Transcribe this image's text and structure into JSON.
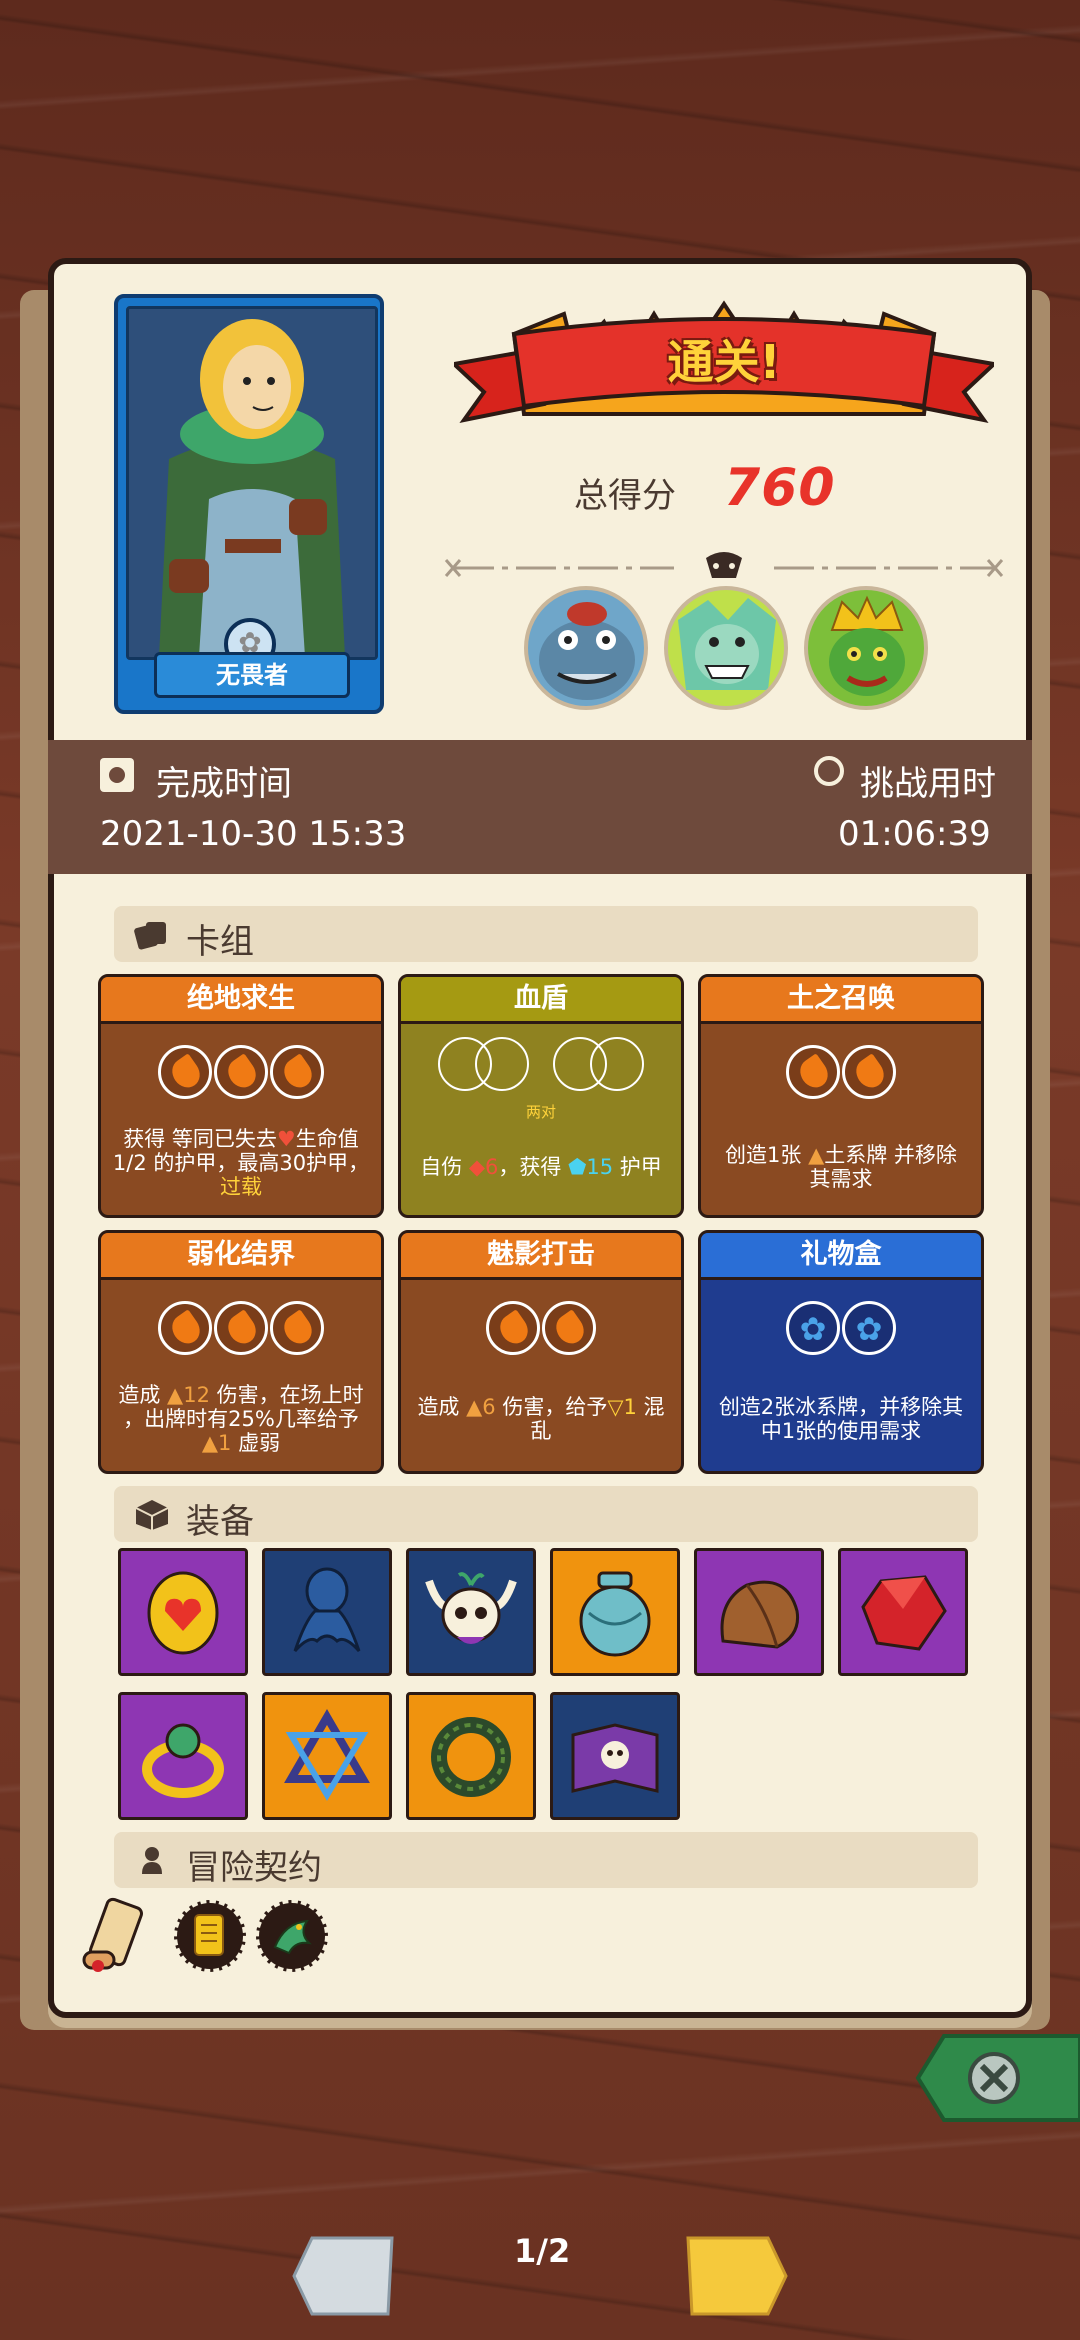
{
  "hero": {
    "name": "无畏者"
  },
  "banner": {
    "text": "通关!"
  },
  "score": {
    "label": "总得分",
    "value": "760"
  },
  "bosses": [
    {
      "name": "boss-toad"
    },
    {
      "name": "boss-fish-monster"
    },
    {
      "name": "boss-goblin-king"
    }
  ],
  "time": {
    "completion_label": "完成时间",
    "completion_value": "2021-10-30 15:33",
    "challenge_label": "挑战用时",
    "challenge_value": "01:06:39"
  },
  "sections": {
    "deck": "卡组",
    "equipment": "装备",
    "contract": "冒险契约"
  },
  "deck": [
    {
      "title": "绝地求生",
      "color": "orange",
      "gems": [
        "fire",
        "fire",
        "fire"
      ],
      "desc": [
        "获得 等同已失去",
        "生命值",
        "1/2 的护甲，最高30护甲，",
        "过载"
      ]
    },
    {
      "title": "血盾",
      "color": "olive",
      "gems": [
        "ring",
        "ring",
        "ring",
        "ring"
      ],
      "sub": "两对",
      "desc": [
        "自伤 ",
        "6",
        "，获得 ",
        "15",
        " 护甲"
      ]
    },
    {
      "title": "土之召唤",
      "color": "orange",
      "gems": [
        "fire",
        "fire"
      ],
      "desc": [
        "创造1张 ",
        "土系牌 并移除",
        "其需求"
      ]
    },
    {
      "title": "弱化结界",
      "color": "orange",
      "gems": [
        "fire",
        "fire",
        "fire"
      ],
      "desc": [
        "造成 ",
        "12",
        " 伤害，在场上时",
        "，出牌时有25%几率给予",
        "1",
        " 虚弱"
      ]
    },
    {
      "title": "魅影打击",
      "color": "orange",
      "gems": [
        "fire",
        "fire"
      ],
      "desc": [
        "造成 ",
        "6",
        " 伤害，给予",
        "1",
        " 混",
        "乱"
      ]
    },
    {
      "title": "礼物盒",
      "color": "blue",
      "gems": [
        "ice",
        "ice"
      ],
      "desc": [
        "创造2张冰系牌，并移除其",
        "中1张的使用需求"
      ]
    }
  ],
  "equipment": [
    {
      "icon": "heart-stone-icon",
      "bg": "purple"
    },
    {
      "icon": "kraken-icon",
      "bg": "navy"
    },
    {
      "icon": "horned-skull-icon",
      "bg": "navy"
    },
    {
      "icon": "vase-icon",
      "bg": "orange"
    },
    {
      "icon": "leather-bag-icon",
      "bg": "purple"
    },
    {
      "icon": "ruby-icon",
      "bg": "purple"
    },
    {
      "icon": "emerald-ring-icon",
      "bg": "purple"
    },
    {
      "icon": "hexagram-amulet-icon",
      "bg": "orange"
    },
    {
      "icon": "horn-ring-icon",
      "bg": "orange"
    },
    {
      "icon": "skull-spellbook-icon",
      "bg": "navy"
    }
  ],
  "contracts": [
    {
      "icon": "scroll-icon"
    },
    {
      "icon": "golden-tablet-icon"
    },
    {
      "icon": "green-bird-icon"
    }
  ],
  "pager": {
    "text": "1/2"
  },
  "colors": {
    "panel": "#f7f0dc",
    "score": "#e8332a",
    "banner": "#ffd23a",
    "close": "#2f8a4a"
  }
}
